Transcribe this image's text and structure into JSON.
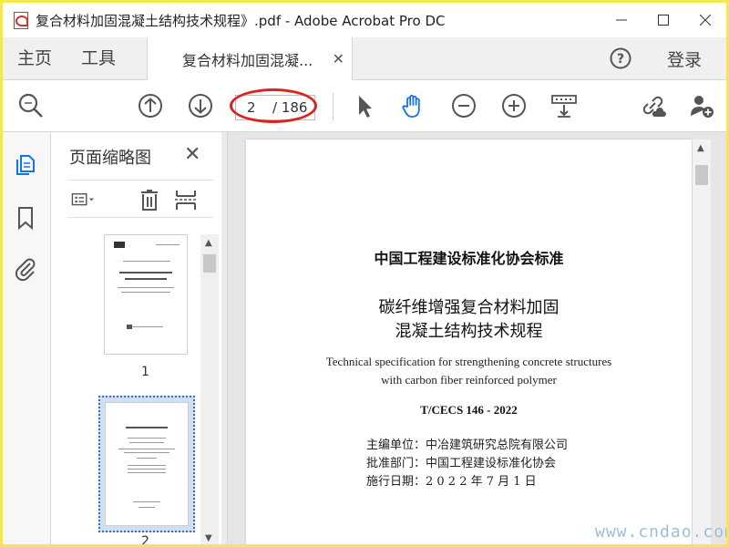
{
  "window": {
    "title": "复合材料加固混凝土结构技术规程》.pdf - Adobe Acrobat Pro DC"
  },
  "tabs": {
    "home": "主页",
    "tools": "工具",
    "document": "复合材料加固混凝...",
    "login": "登录"
  },
  "toolbar": {
    "current_page": "2",
    "total_pages": "/ 186"
  },
  "thumbnails": {
    "title": "页面缩略图",
    "pages": [
      {
        "number": "1"
      },
      {
        "number": "2"
      }
    ]
  },
  "document": {
    "standard_title": "中国工程建设标准化协会标准",
    "cn_title_line1": "碳纤维增强复合材料加固",
    "cn_title_line2": "混凝土结构技术规程",
    "en_title_line1": "Technical specification for strengthening concrete structures",
    "en_title_line2": "with carbon fiber reinforced polymer",
    "standard_code": "T/CECS 146 - 2022",
    "editor": "主编单位：中冶建筑研究总院有限公司",
    "approver": "批准部门：中国工程建设标准化协会",
    "effective_date": "施行日期：2 0 2 2  年  7  月  1  日"
  },
  "watermark": "www.cndao.com",
  "colors": {
    "accent_blue": "#1473e6",
    "annotation_red": "#d9231f",
    "frame_yellow": "#f5e94a"
  },
  "icons": {
    "search": "search-zoom-icon",
    "prev": "arrow-up-circle-icon",
    "next": "arrow-down-circle-icon",
    "select": "cursor-arrow-icon",
    "hand": "hand-tool-icon",
    "zoom_out": "minus-circle-icon",
    "zoom_in": "plus-circle-icon",
    "fit": "fit-page-icon",
    "link": "link-cloud-icon",
    "add_user": "add-user-icon"
  }
}
